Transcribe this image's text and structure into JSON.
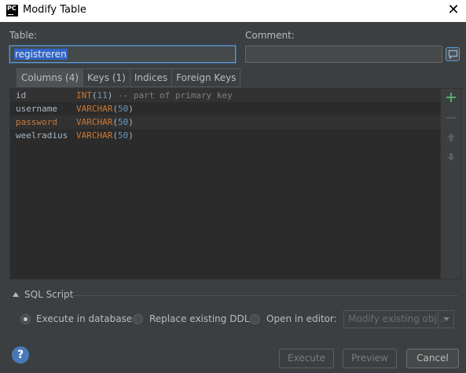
{
  "window": {
    "title": "Modify Table",
    "app_icon_text": "PC"
  },
  "table": {
    "label": "Table:",
    "value": "registreren"
  },
  "comment": {
    "label": "Comment:",
    "value": ""
  },
  "tabs": [
    {
      "label": "Columns (4)",
      "active": true
    },
    {
      "label": "Keys (1)",
      "active": false
    },
    {
      "label": "Indices",
      "active": false
    },
    {
      "label": "Foreign Keys",
      "active": false
    }
  ],
  "columns": [
    {
      "name": "id",
      "type": "INT",
      "size": "11",
      "comment": "-- part of primary key",
      "primary": false
    },
    {
      "name": "username",
      "type": "VARCHAR",
      "size": "50",
      "comment": "",
      "primary": false
    },
    {
      "name": "password",
      "type": "VARCHAR",
      "size": "50",
      "comment": "",
      "primary": true
    },
    {
      "name": "weelradius",
      "type": "VARCHAR",
      "size": "50",
      "comment": "",
      "primary": false
    }
  ],
  "sql_script": {
    "title": "SQL Script",
    "options": [
      {
        "label": "Execute in database",
        "selected": true
      },
      {
        "label": "Replace existing DDL",
        "selected": false
      },
      {
        "label": "Open in editor:",
        "selected": false
      }
    ],
    "editor_select_placeholder": "Modify existing obj..."
  },
  "buttons": {
    "execute": "Execute",
    "preview": "Preview",
    "cancel": "Cancel",
    "help": "?"
  },
  "icons": {
    "add": "plus-icon",
    "remove": "minus-icon",
    "up": "arrow-up-icon",
    "down": "arrow-down-icon",
    "comment": "speech-bubble-icon",
    "close": "close-icon"
  },
  "colors": {
    "accent": "#5e9ad2",
    "selection": "#2f65ca",
    "keyword": "#cc7832",
    "number": "#6897bb",
    "add_green": "#59a869"
  }
}
